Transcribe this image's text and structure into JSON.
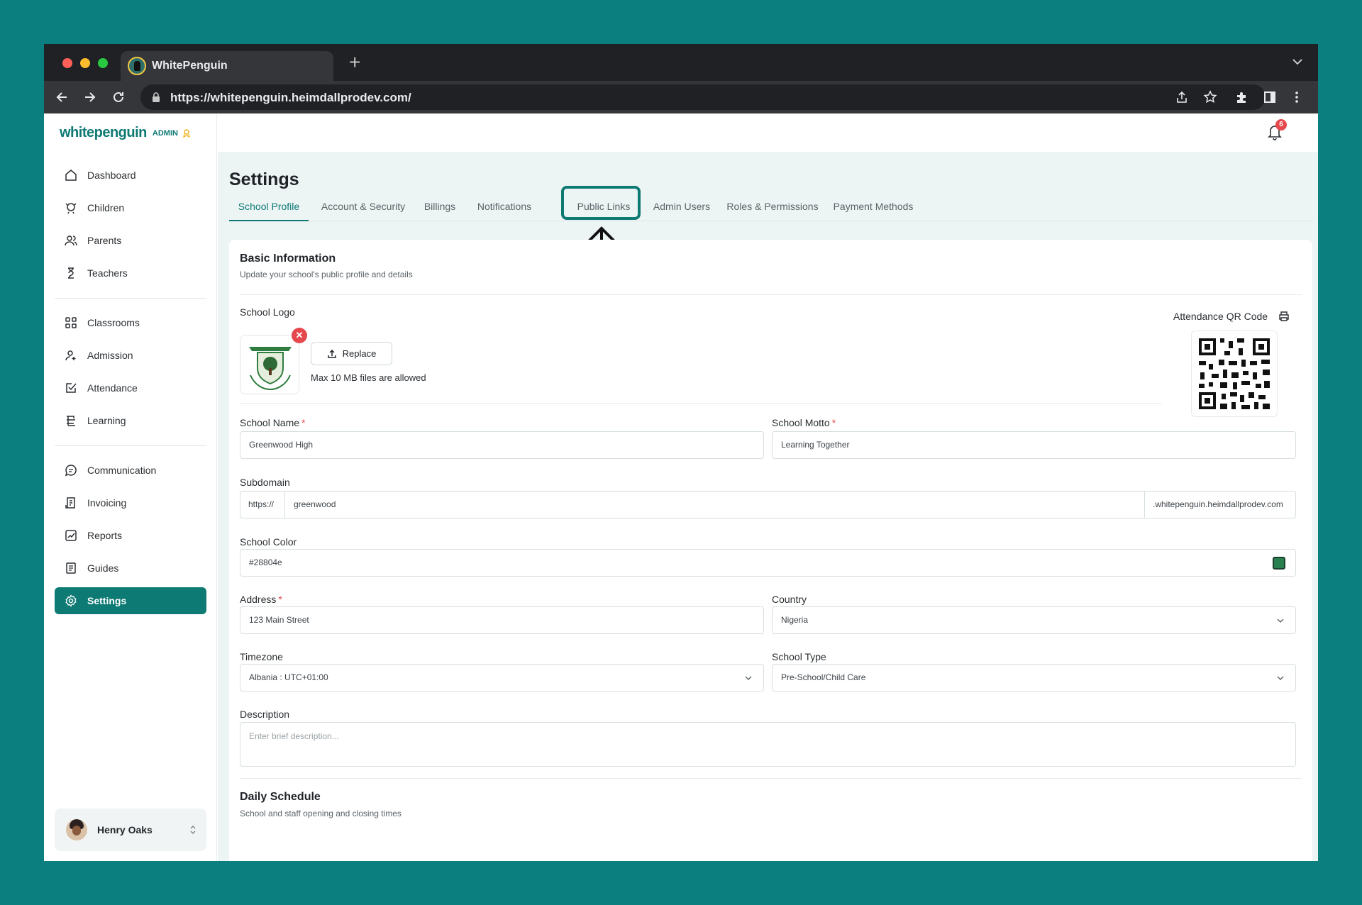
{
  "browser": {
    "tab_title": "WhitePenguin",
    "url": "https://whitepenguin.heimdallprodev.com/"
  },
  "brand": {
    "name": "whitepenguin",
    "tag": "ADMIN"
  },
  "sidebar": {
    "groups": [
      [
        {
          "label": "Dashboard",
          "icon": "home-icon"
        },
        {
          "label": "Children",
          "icon": "child-icon"
        },
        {
          "label": "Parents",
          "icon": "users-icon"
        },
        {
          "label": "Teachers",
          "icon": "teacher-icon"
        }
      ],
      [
        {
          "label": "Classrooms",
          "icon": "grid-icon"
        },
        {
          "label": "Admission",
          "icon": "user-add-icon"
        },
        {
          "label": "Attendance",
          "icon": "check-square-icon"
        },
        {
          "label": "Learning",
          "icon": "book-icon"
        }
      ],
      [
        {
          "label": "Communication",
          "icon": "chat-icon"
        },
        {
          "label": "Invoicing",
          "icon": "receipt-icon"
        },
        {
          "label": "Reports",
          "icon": "chart-icon"
        },
        {
          "label": "Guides",
          "icon": "document-icon"
        },
        {
          "label": "Settings",
          "icon": "gear-icon",
          "active": true
        }
      ]
    ],
    "user": {
      "name": "Henry Oaks"
    }
  },
  "notifications": {
    "count": "6"
  },
  "page": {
    "title": "Settings"
  },
  "tabs": [
    {
      "label": "School Profile",
      "active": true
    },
    {
      "label": "Account & Security"
    },
    {
      "label": "Billings"
    },
    {
      "label": "Notifications"
    },
    {
      "label": "Public Links",
      "highlighted": true
    },
    {
      "label": "Admin Users"
    },
    {
      "label": "Roles & Permissions"
    },
    {
      "label": "Payment Methods"
    }
  ],
  "basic_info": {
    "title": "Basic Information",
    "subtitle": "Update your school's public profile and details",
    "logo_label": "School Logo",
    "replace_label": "Replace",
    "max_note": "Max 10 MB files are allowed",
    "qr_label": "Attendance QR Code"
  },
  "form": {
    "school_name": {
      "label": "School Name",
      "value": "Greenwood High"
    },
    "school_motto": {
      "label": "School Motto",
      "value": "Learning Together"
    },
    "subdomain": {
      "label": "Subdomain",
      "prefix": "https://",
      "value": "greenwood",
      "suffix": ".whitepenguin.heimdallprodev.com"
    },
    "school_color": {
      "label": "School Color",
      "value": "#28804e"
    },
    "address": {
      "label": "Address",
      "value": "123 Main Street"
    },
    "country": {
      "label": "Country",
      "value": "Nigeria"
    },
    "timezone": {
      "label": "Timezone",
      "value": "Albania : UTC+01:00"
    },
    "school_type": {
      "label": "School Type",
      "value": "Pre-School/Child Care"
    },
    "description": {
      "label": "Description",
      "placeholder": "Enter brief description..."
    }
  },
  "daily_schedule": {
    "title": "Daily Schedule",
    "subtitle": "School and staff opening and closing times"
  },
  "colors": {
    "accent": "#0e7a74",
    "background": "#0b7f80",
    "school_color": "#28804e",
    "badge": "#e5484d"
  }
}
